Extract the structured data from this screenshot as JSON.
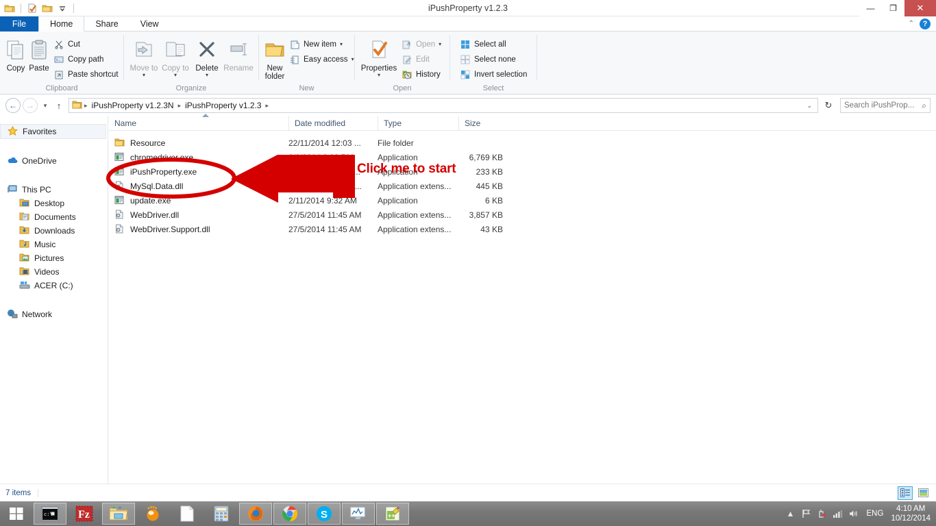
{
  "window": {
    "title": "iPushProperty v1.2.3",
    "minimize_label": "—",
    "restore_label": "❐",
    "close_label": "✕"
  },
  "quick_access": [
    {
      "name": "folder-icon",
      "label": "Folder"
    },
    {
      "name": "properties-icon",
      "label": "Properties"
    },
    {
      "name": "new-folder-icon",
      "label": "New folder"
    },
    {
      "name": "customize-chevron-icon",
      "label": "Customize Quick Access Toolbar"
    }
  ],
  "tabs": [
    {
      "id": "file",
      "label": "File"
    },
    {
      "id": "home",
      "label": "Home"
    },
    {
      "id": "share",
      "label": "Share"
    },
    {
      "id": "view",
      "label": "View"
    }
  ],
  "tabrow_right": {
    "collapse_ribbon": "⌃",
    "help": "?"
  },
  "ribbon": {
    "groups": [
      {
        "id": "clipboard",
        "label": "Clipboard",
        "big": [
          {
            "label": "Copy",
            "icon": "copy-icon",
            "disabled": false
          },
          {
            "label": "Paste",
            "icon": "paste-icon",
            "disabled": false
          }
        ],
        "small": [
          {
            "label": "Cut",
            "icon": "scissors-icon",
            "disabled": false
          },
          {
            "label": "Copy path",
            "icon": "copy-path-icon",
            "disabled": false
          },
          {
            "label": "Paste shortcut",
            "icon": "paste-shortcut-icon",
            "disabled": false
          }
        ]
      },
      {
        "id": "organize",
        "label": "Organize",
        "big": [
          {
            "label": "Move to",
            "icon": "move-to-icon",
            "disabled": true,
            "caret": true
          },
          {
            "label": "Copy to",
            "icon": "copy-to-icon",
            "disabled": true,
            "caret": true
          },
          {
            "label": "Delete",
            "icon": "delete-icon",
            "disabled": false,
            "caret": true
          },
          {
            "label": "Rename",
            "icon": "rename-icon",
            "disabled": true
          }
        ],
        "small": []
      },
      {
        "id": "new",
        "label": "New",
        "big": [
          {
            "label": "New folder",
            "icon": "new-folder-icon",
            "disabled": false
          }
        ],
        "small": [
          {
            "label": "New item",
            "icon": "new-item-icon",
            "disabled": false,
            "caret": true
          },
          {
            "label": "Easy access",
            "icon": "easy-access-icon",
            "disabled": false,
            "caret": true
          }
        ]
      },
      {
        "id": "open",
        "label": "Open",
        "big": [
          {
            "label": "Properties",
            "icon": "properties-icon",
            "disabled": false,
            "caret": true
          }
        ],
        "small": [
          {
            "label": "Open",
            "icon": "open-icon",
            "disabled": true,
            "caret": true
          },
          {
            "label": "Edit",
            "icon": "edit-icon",
            "disabled": true
          },
          {
            "label": "History",
            "icon": "history-icon",
            "disabled": false
          }
        ]
      },
      {
        "id": "select",
        "label": "Select",
        "big": [],
        "small": [
          {
            "label": "Select all",
            "icon": "select-all-icon",
            "disabled": false
          },
          {
            "label": "Select none",
            "icon": "select-none-icon",
            "disabled": false
          },
          {
            "label": "Invert selection",
            "icon": "invert-selection-icon",
            "disabled": false
          }
        ]
      }
    ]
  },
  "address": {
    "back_label": "←",
    "forward_label": "→",
    "recent_caret": "▾",
    "up_label": "↑",
    "breadcrumbs": [
      "iPushProperty v1.2.3N",
      "iPushProperty v1.2.3"
    ],
    "separator": "▸",
    "dropdown": "⌄",
    "refresh": "↻",
    "search_placeholder": "Search iPushProp...",
    "search_value": ""
  },
  "navpane": {
    "groups": [
      {
        "items": [
          {
            "label": "Favorites",
            "icon": "star-icon",
            "selected": true,
            "level": 0
          }
        ]
      },
      {
        "items": [
          {
            "label": "OneDrive",
            "icon": "onedrive-cloud-icon",
            "selected": false,
            "level": 0
          }
        ]
      },
      {
        "items": [
          {
            "label": "This PC",
            "icon": "this-pc-icon",
            "selected": false,
            "level": 0
          },
          {
            "label": "Desktop",
            "icon": "desktop-folder-icon",
            "selected": false,
            "level": 1
          },
          {
            "label": "Documents",
            "icon": "documents-folder-icon",
            "selected": false,
            "level": 1
          },
          {
            "label": "Downloads",
            "icon": "downloads-folder-icon",
            "selected": false,
            "level": 1
          },
          {
            "label": "Music",
            "icon": "music-folder-icon",
            "selected": false,
            "level": 1
          },
          {
            "label": "Pictures",
            "icon": "pictures-folder-icon",
            "selected": false,
            "level": 1
          },
          {
            "label": "Videos",
            "icon": "videos-folder-icon",
            "selected": false,
            "level": 1
          },
          {
            "label": "ACER (C:)",
            "icon": "hard-drive-icon",
            "selected": false,
            "level": 1
          }
        ]
      },
      {
        "items": [
          {
            "label": "Network",
            "icon": "network-icon",
            "selected": false,
            "level": 0
          }
        ]
      }
    ]
  },
  "filelist": {
    "columns": [
      "Name",
      "Date modified",
      "Type",
      "Size"
    ],
    "sort_column": "Name",
    "sort_direction": "ascending",
    "rows": [
      {
        "name": "Resource",
        "date": "22/11/2014 12:03 ...",
        "type": "File folder",
        "size": "",
        "icon": "folder-icon"
      },
      {
        "name": "chromedriver.exe",
        "date": "6/2/2014 6:09 PM",
        "type": "Application",
        "size": "6,769 KB",
        "icon": "exe-icon"
      },
      {
        "name": "iPushProperty.exe",
        "date": "21/11/2014 11:22 ...",
        "type": "Application",
        "size": "233 KB",
        "icon": "exe-icon"
      },
      {
        "name": "MySql.Data.dll",
        "date": "18/12/2013 12:13 ...",
        "type": "Application extens...",
        "size": "445 KB",
        "icon": "dll-icon"
      },
      {
        "name": "update.exe",
        "date": "2/11/2014 9:32 AM",
        "type": "Application",
        "size": "6 KB",
        "icon": "exe-icon"
      },
      {
        "name": "WebDriver.dll",
        "date": "27/5/2014 11:45 AM",
        "type": "Application extens...",
        "size": "3,857 KB",
        "icon": "dll-icon"
      },
      {
        "name": "WebDriver.Support.dll",
        "date": "27/5/2014 11:45 AM",
        "type": "Application extens...",
        "size": "43 KB",
        "icon": "dll-icon"
      }
    ]
  },
  "annotation": {
    "text": "Click me to start",
    "color": "#d00000",
    "shapes": [
      "ellipse-highlight",
      "left-arrow"
    ]
  },
  "statusbar": {
    "item_count": "7 items",
    "view_details_label": "Details view",
    "view_large_icons_label": "Large icons view"
  },
  "taskbar": {
    "start_label": "Start",
    "items": [
      {
        "name": "command-prompt-icon",
        "label": "Command Prompt",
        "open": true
      },
      {
        "name": "filezilla-icon",
        "label": "FileZilla",
        "open": false
      },
      {
        "name": "file-explorer-icon",
        "label": "File Explorer",
        "open": true
      },
      {
        "name": "vlc-icon",
        "label": "VLC media player",
        "open": false
      },
      {
        "name": "notepad-icon",
        "label": "Notepad",
        "open": false
      },
      {
        "name": "calculator-icon",
        "label": "Calculator",
        "open": false
      },
      {
        "name": "firefox-icon",
        "label": "Mozilla Firefox",
        "open": true
      },
      {
        "name": "chrome-icon",
        "label": "Google Chrome",
        "open": true
      },
      {
        "name": "skype-icon",
        "label": "Skype",
        "open": true
      },
      {
        "name": "resource-monitor-icon",
        "label": "Resource Monitor",
        "open": true
      },
      {
        "name": "notepad-plus-plus-icon",
        "label": "Notepad++",
        "open": true
      }
    ],
    "tray": {
      "show_hidden": "▲",
      "action_center": "flag-icon",
      "battery": "battery-error-icon",
      "network": "signal-bars-icon",
      "volume": "speaker-icon",
      "language": "ENG",
      "time": "4:10 AM",
      "date": "10/12/2014"
    }
  }
}
